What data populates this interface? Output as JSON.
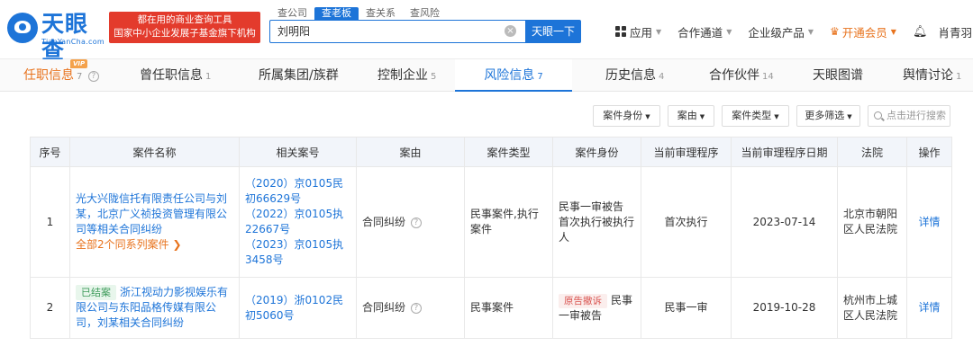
{
  "header": {
    "logo_text": "天眼查",
    "logo_sub": "TianYanCha.com",
    "slogan_line1": "都在用的商业查询工具",
    "slogan_line2": "国家中小企业发展子基金旗下机构",
    "search_tabs": [
      "查公司",
      "查老板",
      "查关系",
      "查风险"
    ],
    "search_value": "刘明阳",
    "search_button": "天眼一下",
    "nav": {
      "apps": "应用",
      "channel": "合作通道",
      "enterprise": "企业级产品",
      "vip": "开通会员",
      "user": "肖青羽"
    }
  },
  "subtabs": {
    "vip_badge": "VIP",
    "items": [
      {
        "label": "任职信息",
        "count": "7"
      },
      {
        "label": "曾任职信息",
        "count": "1"
      },
      {
        "label": "所属集团/族群",
        "count": ""
      },
      {
        "label": "控制企业",
        "count": "5"
      },
      {
        "label": "风险信息",
        "count": "7"
      },
      {
        "label": "历史信息",
        "count": "4"
      },
      {
        "label": "合作伙伴",
        "count": "14"
      },
      {
        "label": "天眼图谱",
        "count": ""
      },
      {
        "label": "舆情讨论",
        "count": "1"
      }
    ]
  },
  "filters": {
    "role": "案件身份",
    "cause": "案由",
    "type": "案件类型",
    "more": "更多筛选",
    "search_placeholder": "点击进行搜索"
  },
  "table": {
    "headers": [
      "序号",
      "案件名称",
      "相关案号",
      "案由",
      "案件类型",
      "案件身份",
      "当前审理程序",
      "当前审理程序日期",
      "法院",
      "操作"
    ],
    "rows": [
      {
        "index": "1",
        "tag": "",
        "name": "光大兴陇信托有限责任公司与刘某，北京广义祯投资管理有限公司等相关合同纠纷",
        "more": "全部2个同系列案件",
        "case_numbers": [
          "（2020）京0105民初66629号",
          "（2022）京0105执22667号",
          "（2023）京0105执3458号"
        ],
        "cause": "合同纠纷",
        "case_type": "民事案件,执行案件",
        "role_tag": "",
        "role": "民事一审被告\n首次执行被执行人",
        "stage": "首次执行",
        "date": "2023-07-14",
        "court": "北京市朝阳区人民法院",
        "action": "详情"
      },
      {
        "index": "2",
        "tag": "已结案",
        "name": "浙江视动力影视娱乐有限公司与东阳品格传媒有限公司，刘某相关合同纠纷",
        "more": "",
        "case_numbers": [
          "（2019）浙0102民初5060号"
        ],
        "cause": "合同纠纷",
        "case_type": "民事案件",
        "role_tag": "原告撤诉",
        "role": "民事一审被告",
        "stage": "民事一审",
        "date": "2019-10-28",
        "court": "杭州市上城区人民法院",
        "action": "详情"
      }
    ]
  },
  "colors": {
    "brand": "#1d74d8",
    "accent_orange": "#e8731d",
    "slogan_red": "#e33b2c"
  }
}
